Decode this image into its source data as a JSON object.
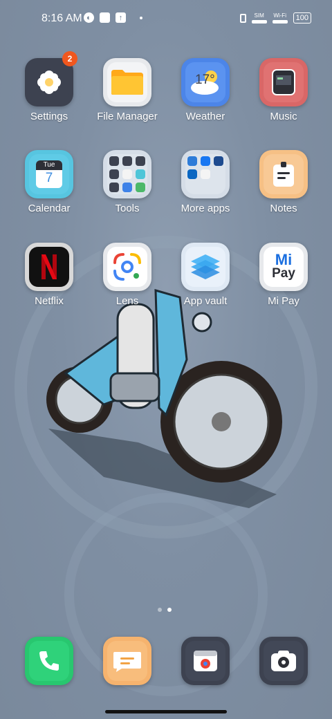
{
  "status_bar": {
    "time": "8:16 AM",
    "sim_label": "SIM",
    "wifi_label": "Wi-Fi",
    "battery": "100"
  },
  "apps": [
    {
      "label": "Settings",
      "badge": "2",
      "icon": "settings-icon",
      "color": "#3d4250"
    },
    {
      "label": "File Manager",
      "icon": "folder-icon",
      "color": "#ffb21d"
    },
    {
      "label": "Weather",
      "icon": "weather-icon",
      "weather_temp": "17°",
      "color": "#4c85e8"
    },
    {
      "label": "Music",
      "icon": "music-icon",
      "color": "#d96767"
    },
    {
      "label": "Calendar",
      "icon": "calendar-icon",
      "cal_day": "Tue",
      "cal_date": "7",
      "color": "#57c5e0"
    },
    {
      "label": "Tools",
      "icon": "tools-folder-icon",
      "color": "#e8eef5"
    },
    {
      "label": "More apps",
      "icon": "more-apps-folder-icon",
      "color": "#e8eef5"
    },
    {
      "label": "Notes",
      "icon": "notes-icon",
      "color": "#f6c085"
    },
    {
      "label": "Netflix",
      "icon": "netflix-icon",
      "color": "#111111"
    },
    {
      "label": "Lens",
      "icon": "google-lens-icon",
      "color": "#ffffff"
    },
    {
      "label": "App vault",
      "icon": "app-vault-icon",
      "color": "#dfe9f4"
    },
    {
      "label": "Mi Pay",
      "icon": "mi-pay-icon",
      "color": "#ffffff",
      "brand_top": "Mi",
      "brand_bottom": "Pay"
    }
  ],
  "dock": [
    {
      "name": "phone",
      "icon": "phone-icon",
      "color": "#28c76f"
    },
    {
      "name": "messages",
      "icon": "messages-icon",
      "color": "#f6b36e"
    },
    {
      "name": "browser",
      "icon": "browser-icon",
      "color": "#3d4250"
    },
    {
      "name": "camera",
      "icon": "camera-icon",
      "color": "#3d4250"
    }
  ],
  "pager": {
    "pages": 2,
    "active": 2
  }
}
